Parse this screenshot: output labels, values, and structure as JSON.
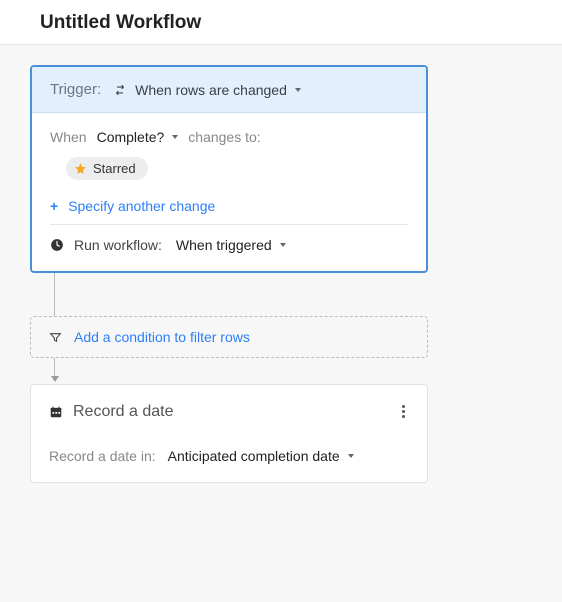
{
  "header": {
    "title": "Untitled Workflow"
  },
  "trigger": {
    "label": "Trigger:",
    "type": "When rows are changed",
    "when_label": "When",
    "field": "Complete?",
    "changes_to_label": "changes to:",
    "value": "Starred",
    "specify_another": "Specify another change",
    "run_label": "Run workflow:",
    "run_value": "When triggered"
  },
  "condition": {
    "text": "Add a condition to filter rows"
  },
  "action": {
    "title": "Record a date",
    "field_label": "Record a date in:",
    "field_value": "Anticipated completion date"
  }
}
